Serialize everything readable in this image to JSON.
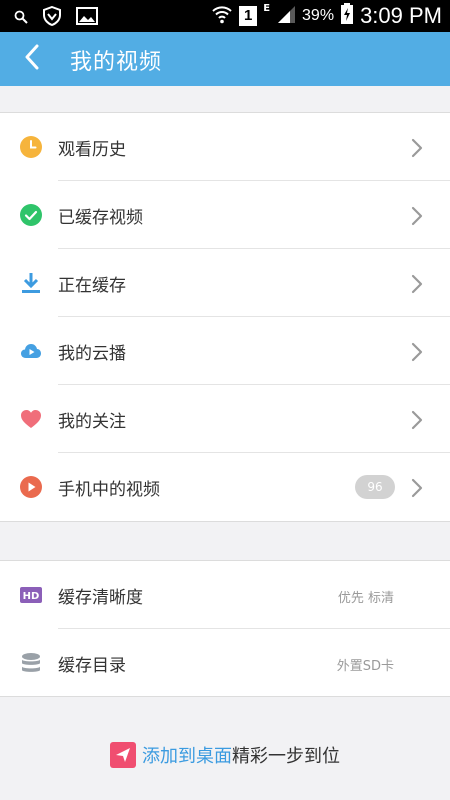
{
  "status_bar": {
    "network_type": "E",
    "sim_slot": "1",
    "battery": "39%",
    "time": "3:09 PM"
  },
  "app_bar": {
    "title": "我的视频"
  },
  "menu": [
    {
      "label": "观看历史",
      "icon": "clock-icon",
      "color": "#f6b43c"
    },
    {
      "label": "已缓存视频",
      "icon": "check-circle-icon",
      "color": "#2fc46a"
    },
    {
      "label": "正在缓存",
      "icon": "download-icon",
      "color": "#3d9be0"
    },
    {
      "label": "我的云播",
      "icon": "cloud-play-icon",
      "color": "#45a0e2"
    },
    {
      "label": "我的关注",
      "icon": "heart-icon",
      "color": "#f06e7a"
    },
    {
      "label": "手机中的视频",
      "icon": "play-circle-icon",
      "color": "#ea6a4e",
      "badge": "96"
    }
  ],
  "settings": [
    {
      "label": "缓存清晰度",
      "icon": "hd-icon",
      "color": "#8b5fb8",
      "value": "优先 标清"
    },
    {
      "label": "缓存目录",
      "icon": "storage-icon",
      "color": "#9aa1a8",
      "value": "外置SD卡"
    }
  ],
  "footer": {
    "link": "添加到桌面",
    "text": "精彩一步到位",
    "icon_color": "#f04e70"
  },
  "colors": {
    "accent": "#52ade4",
    "status_bar": "#000000",
    "background": "#f2f2f4"
  }
}
